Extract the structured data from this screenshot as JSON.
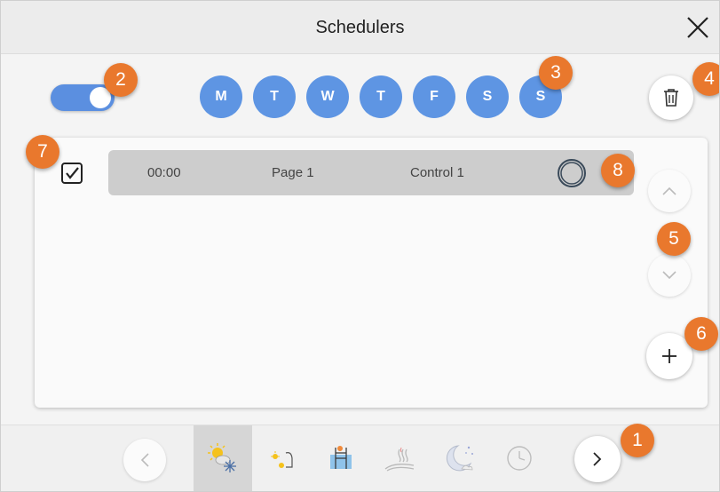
{
  "dialog": {
    "title": "Schedulers"
  },
  "toggle": {
    "state": "on"
  },
  "days": [
    {
      "label": "M",
      "selected": true
    },
    {
      "label": "T",
      "selected": true
    },
    {
      "label": "W",
      "selected": true
    },
    {
      "label": "T",
      "selected": true
    },
    {
      "label": "F",
      "selected": true
    },
    {
      "label": "S",
      "selected": true
    },
    {
      "label": "S",
      "selected": true
    }
  ],
  "schedule_rows": [
    {
      "checked": true,
      "time": "00:00",
      "page": "Page 1",
      "control": "Control 1"
    }
  ],
  "bottom_nav": {
    "tabs": [
      {
        "icon": "sun-snow-climate-icon",
        "active": true
      },
      {
        "icon": "lights-icon",
        "active": false
      },
      {
        "icon": "pool-icon",
        "active": false
      },
      {
        "icon": "heating-icon",
        "active": false
      },
      {
        "icon": "night-moon-icon",
        "active": false
      },
      {
        "icon": "clock-icon",
        "active": false
      }
    ]
  },
  "callouts": [
    "1",
    "2",
    "3",
    "4",
    "5",
    "6",
    "7",
    "8"
  ],
  "colors": {
    "accent_blue": "#5e95e3",
    "callout_orange": "#e9782d",
    "row_gray": "#cdcdcd"
  }
}
